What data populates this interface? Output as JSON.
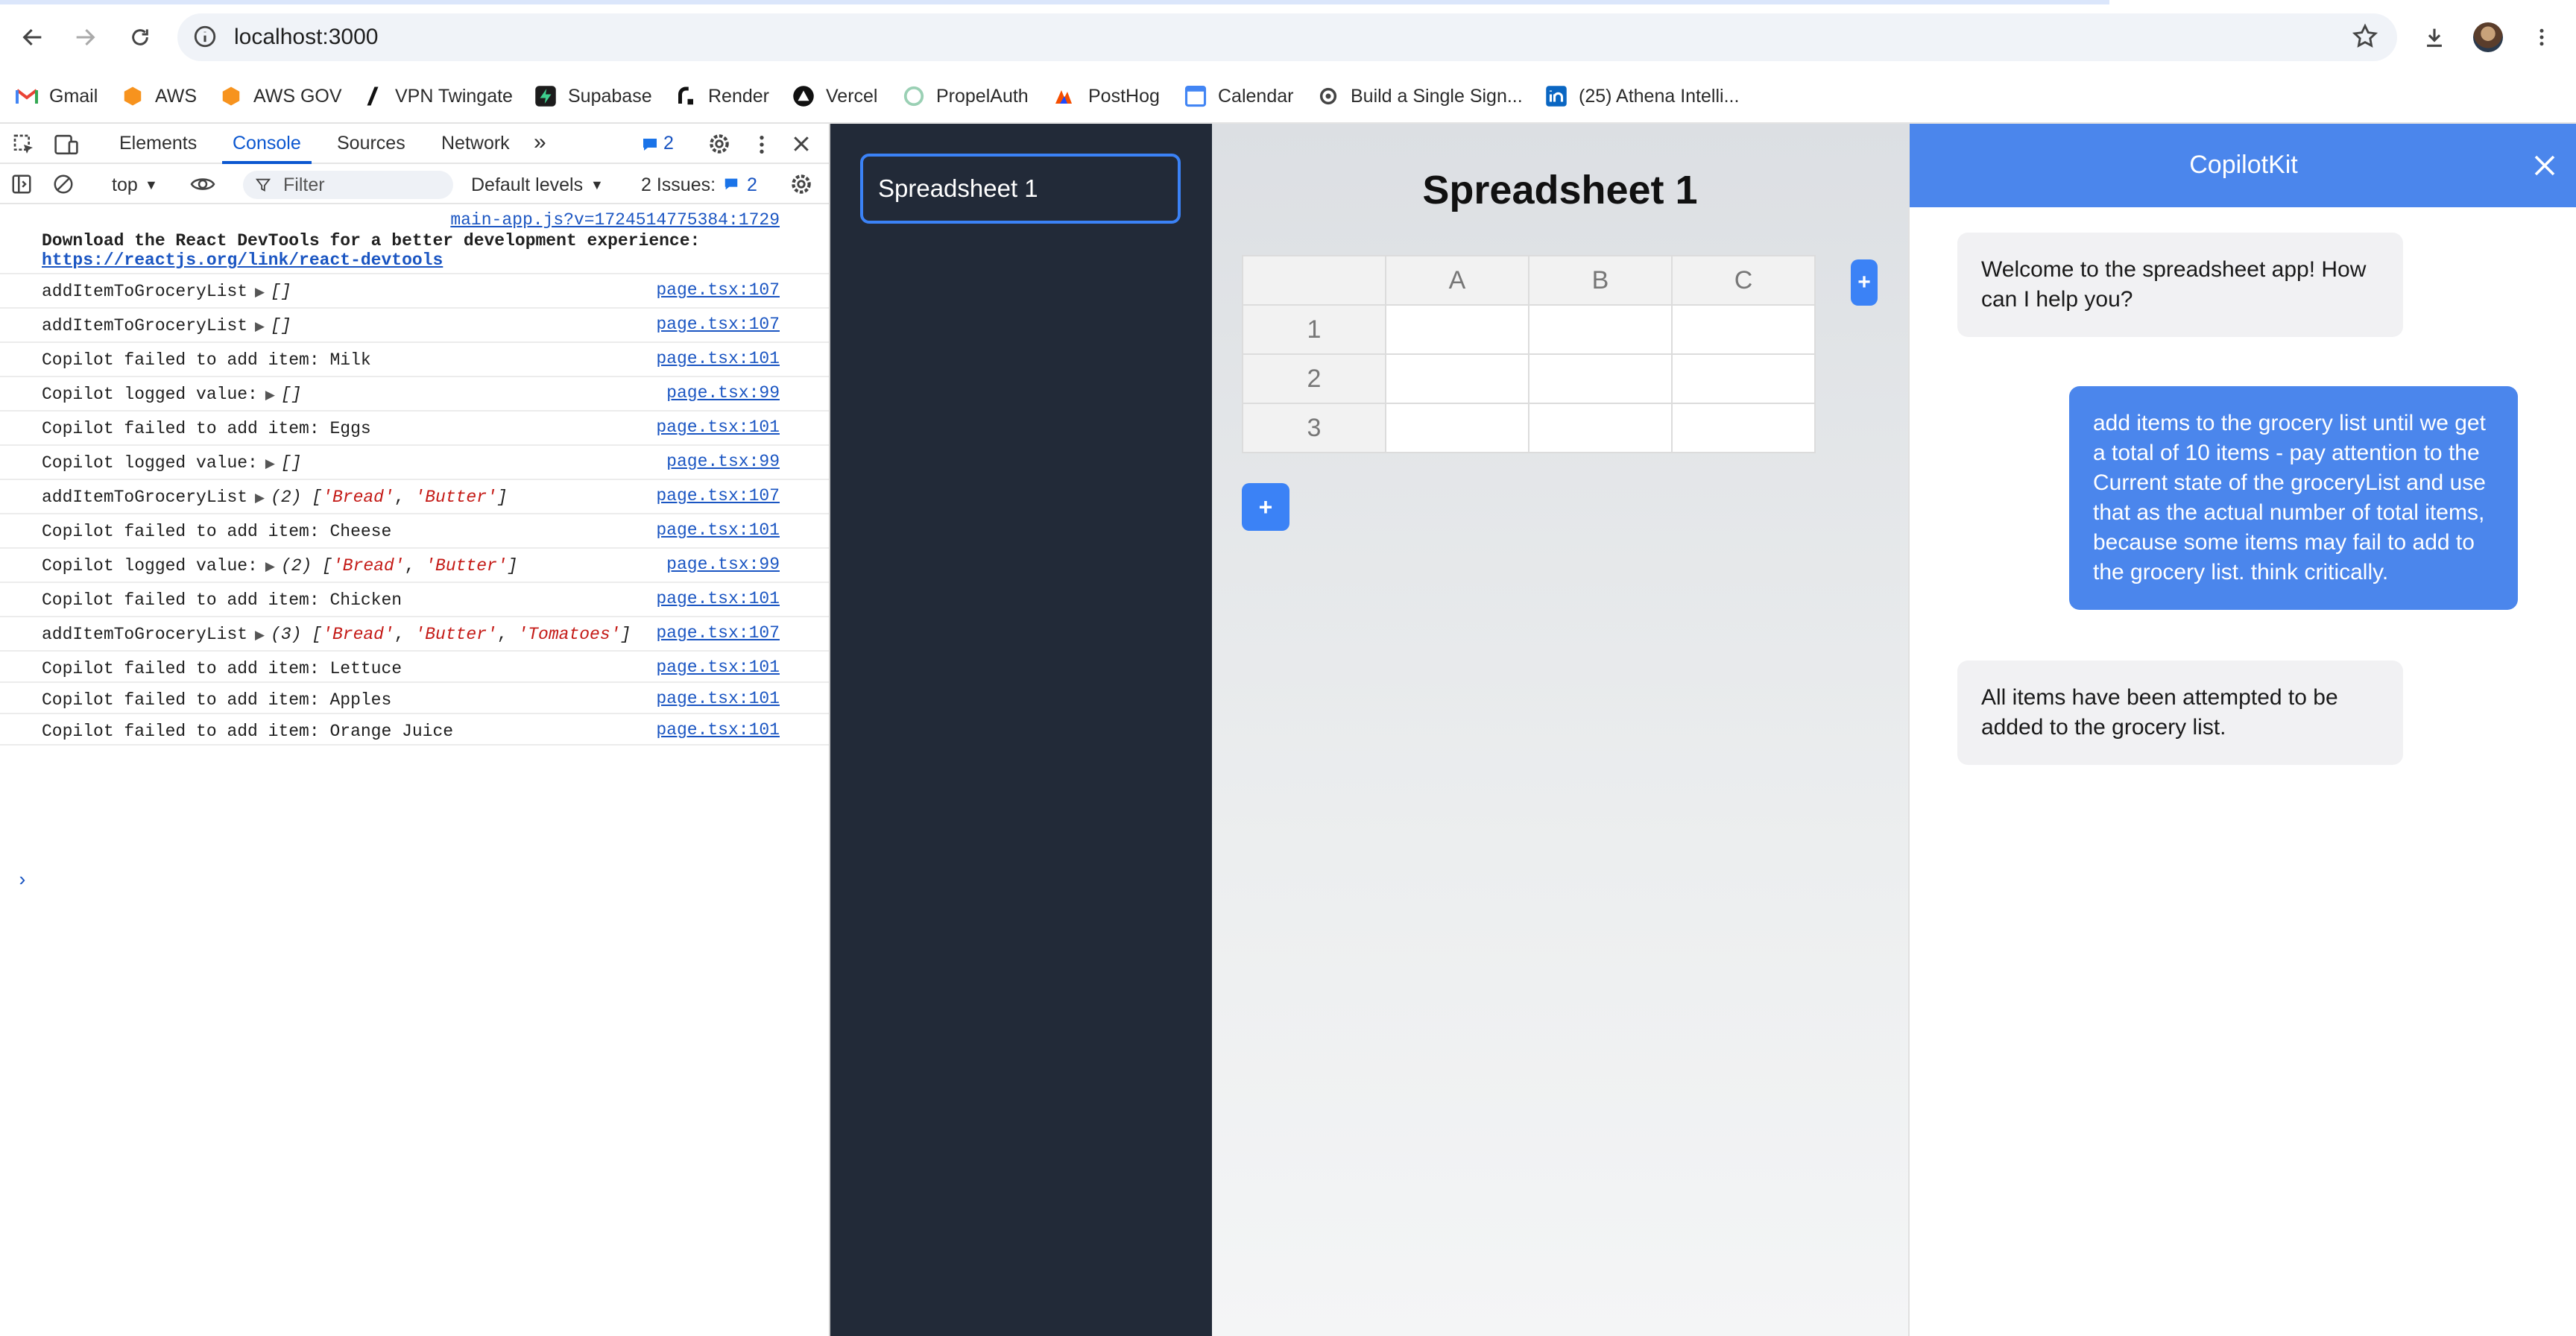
{
  "browser": {
    "url": "localhost:3000",
    "bookmarks": [
      "Gmail",
      "AWS",
      "AWS GOV",
      "VPN Twingate",
      "Supabase",
      "Render",
      "Vercel",
      "PropelAuth",
      "PostHog",
      "Calendar",
      "Build a Single Sign...",
      "(25) Athena Intelli..."
    ]
  },
  "devtools": {
    "tabs": [
      "Elements",
      "Console",
      "Sources",
      "Network"
    ],
    "issues_badge": "2",
    "context": "top",
    "filter_placeholder": "Filter",
    "levels": "Default levels",
    "issues_label": "2 Issues:",
    "issues_count": "2",
    "logs": [
      {
        "src": "main-app.js?v=1724514775384:1729"
      },
      {
        "msg": "addItemToGroceryList",
        "val": "[]",
        "src": "page.tsx:107"
      },
      {
        "msg": "addItemToGroceryList",
        "val": "[]",
        "src": "page.tsx:107"
      },
      {
        "msg": "Copilot failed to add item: Milk",
        "src": "page.tsx:101"
      },
      {
        "msg": "Copilot logged value:",
        "val": "[]",
        "src": "page.tsx:99"
      },
      {
        "msg": "Copilot failed to add item: Eggs",
        "src": "page.tsx:101"
      },
      {
        "msg": "Copilot logged value:",
        "val": "[]",
        "src": "page.tsx:99"
      },
      {
        "msg": "addItemToGroceryList",
        "len": "(2)",
        "items": [
          "'Bread'",
          "'Butter'"
        ],
        "src": "page.tsx:107"
      },
      {
        "msg": "Copilot failed to add item: Cheese",
        "src": "page.tsx:101"
      },
      {
        "msg": "Copilot logged value:",
        "len": "(2)",
        "items": [
          "'Bread'",
          "'Butter'"
        ],
        "src": "page.tsx:99"
      },
      {
        "msg": "Copilot failed to add item: Chicken",
        "src": "page.tsx:101"
      },
      {
        "msg": "addItemToGroceryList",
        "len": "(3)",
        "items": [
          "'Bread'",
          "'Butter'",
          "'Tomatoes'"
        ],
        "src": "page.tsx:107"
      },
      {
        "msg": "Copilot failed to add item: Lettuce",
        "src": "page.tsx:101"
      },
      {
        "msg": "Copilot failed to add item: Apples",
        "src": "page.tsx:101"
      },
      {
        "msg": "Copilot failed to add item: Orange Juice",
        "src": "page.tsx:101"
      }
    ],
    "react_devtools_line1": "Download the React DevTools for a better development experience:",
    "react_devtools_link": "https://reactjs.org/link/react-devtools"
  },
  "app": {
    "sidebar_item": "Spreadsheet 1",
    "sheet_title": "Spreadsheet 1",
    "columns": [
      "A",
      "B",
      "C"
    ],
    "rows": [
      "1",
      "2",
      "3"
    ],
    "add_label": "+"
  },
  "copilot": {
    "title": "CopilotKit",
    "messages": [
      {
        "role": "bot",
        "text": "Welcome to the spreadsheet app! How can I help you?"
      },
      {
        "role": "user",
        "text": "add items to the grocery list until we get a total of 10 items - pay attention to the Current state of the groceryList and use that as the actual number of total items, because some items may fail to add to the grocery list. think critically."
      },
      {
        "role": "bot",
        "text": "All items have been attempted to be added to the grocery list."
      }
    ]
  },
  "colors": {
    "accent": "#3b82f6",
    "copilot_header": "#4b86ec",
    "sidebar": "#222a38",
    "link": "#1a55c2"
  }
}
